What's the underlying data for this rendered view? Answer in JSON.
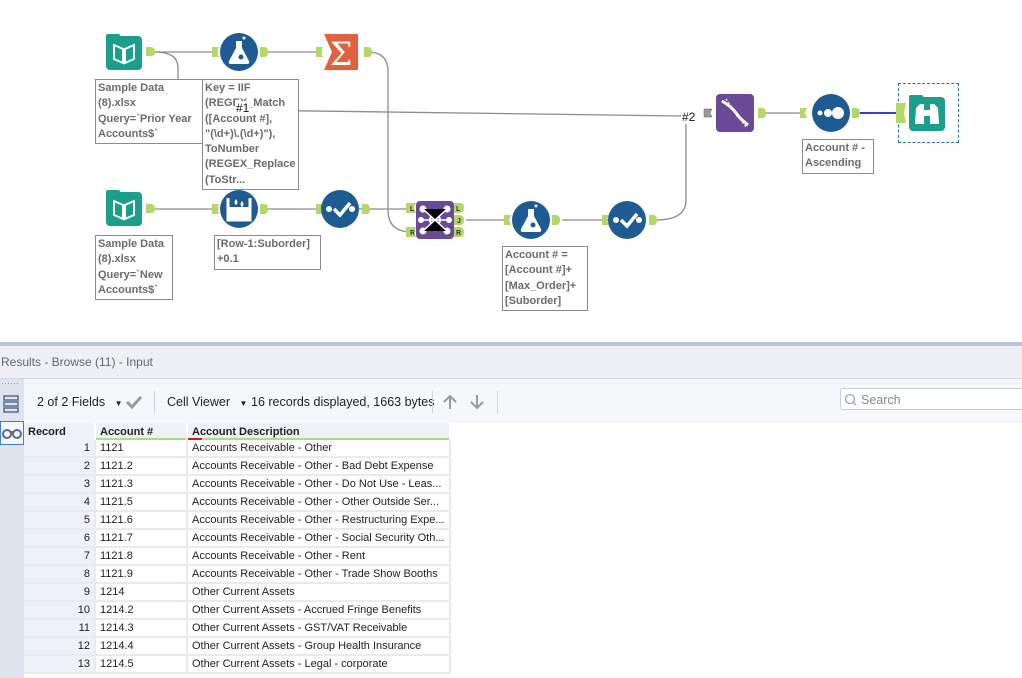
{
  "workflow": {
    "annotations": {
      "input1": "Sample Data\n(8).xlsx\nQuery=`Prior Year\nAccounts$`",
      "formula1": "Key = IIF\n(REGEX_Match\n([Account #],\n\"(\\d+)\\.(\\d+)\"),\nToNumber\n(REGEX_Replace\n(ToStr...",
      "input2": "Sample Data\n(8).xlsx\nQuery=`New\nAccounts$`",
      "multirow": "[Row-1:Suborder]\n+0.1",
      "formula2": "Account # =\n[Account #]+\n[Max_Order]+\n[Suborder]",
      "sort": "Account # -\nAscending"
    },
    "wire_labels": {
      "w1": "#1",
      "w2": "#2"
    },
    "join_anchors": {
      "in_left": "L",
      "in_right": "R",
      "out_left": "L",
      "out_join": "J",
      "out_right": "R"
    },
    "colors": {
      "input_teal": "#1b9e8a",
      "formula_blue": "#1f5b93",
      "summarize_orange": "#e0603f",
      "join_purple": "#6a4996",
      "anchor_green": "#b4d867",
      "selected_wire": "#3a3ad4"
    }
  },
  "results": {
    "title": "Results - Browse (11) - Input",
    "fields_selector": "2 of 2 Fields",
    "viewer_selector": "Cell Viewer",
    "status": "16 records displayed, 1663 bytes",
    "search_placeholder": "Search",
    "columns": [
      "Record",
      "Account #",
      "Account Description"
    ],
    "rows": [
      [
        "1",
        "1121",
        "Accounts Receivable - Other"
      ],
      [
        "2",
        "1121.2",
        "Accounts Receivable - Other - Bad Debt Expense"
      ],
      [
        "3",
        "1121.3",
        "Accounts Receivable - Other - Do Not Use - Leas..."
      ],
      [
        "4",
        "1121.5",
        "Accounts Receivable - Other - Other Outside Ser..."
      ],
      [
        "5",
        "1121.6",
        "Accounts Receivable - Other - Restructuring Expe..."
      ],
      [
        "6",
        "1121.7",
        "Accounts Receivable - Other - Social Security Oth..."
      ],
      [
        "7",
        "1121.8",
        "Accounts Receivable - Other - Rent"
      ],
      [
        "8",
        "1121.9",
        "Accounts Receivable - Other - Trade Show Booths"
      ],
      [
        "9",
        "1214",
        "Other Current Assets"
      ],
      [
        "10",
        "1214.2",
        "Other Current Assets - Accrued Fringe Benefits"
      ],
      [
        "11",
        "1214.3",
        "Other Current Assets - GST/VAT Receivable"
      ],
      [
        "12",
        "1214.4",
        "Other Current Assets - Group Health Insurance"
      ],
      [
        "13",
        "1214.5",
        "Other Current Assets - Legal - corporate"
      ]
    ]
  }
}
